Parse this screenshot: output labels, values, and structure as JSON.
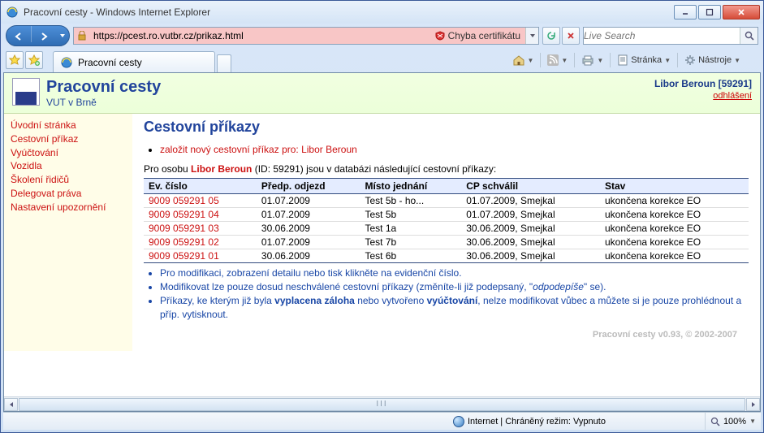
{
  "window": {
    "title": "Pracovní cesty - Windows Internet Explorer",
    "min_tooltip": "Minimize",
    "max_tooltip": "Maximize",
    "close_tooltip": "Close"
  },
  "address": {
    "url": "https://pcest.ro.vutbr.cz/prikaz.html",
    "cert_error": "Chyba certifikátu"
  },
  "search": {
    "placeholder": "Live Search"
  },
  "tab": {
    "title": "Pracovní cesty"
  },
  "cmd": {
    "page": "Stránka",
    "tools": "Nástroje"
  },
  "page": {
    "app_title": "Pracovní cesty",
    "org": "VUT v Brně",
    "user": "Libor Beroun [59291]",
    "logout": "odhlášení",
    "heading": "Cestovní příkazy",
    "new_link": "založit nový cestovní příkaz pro: Libor Beroun",
    "intro_pre": "Pro osobu ",
    "intro_name": "Libor Beroun",
    "intro_post": " (ID: 59291) jsou v databázi následující cestovní příkazy:"
  },
  "sidebar": {
    "items": [
      "Úvodní stránka",
      "Cestovní příkaz",
      "Vyúčtování",
      "Vozidla",
      "Školení řidičů",
      "Delegovat práva",
      "Nastavení upozornění"
    ]
  },
  "table": {
    "headers": {
      "ev": "Ev. číslo",
      "odjezd": "Předp. odjezd",
      "misto": "Místo jednání",
      "schvalil": "CP schválil",
      "stav": "Stav"
    },
    "rows": [
      {
        "ev": "9009 059291 05",
        "odjezd": "01.07.2009",
        "misto": "Test 5b - ho...",
        "schvalil": "01.07.2009, Smejkal",
        "stav": "ukončena korekce EO"
      },
      {
        "ev": "9009 059291 04",
        "odjezd": "01.07.2009",
        "misto": "Test 5b",
        "schvalil": "01.07.2009, Smejkal",
        "stav": "ukončena korekce EO"
      },
      {
        "ev": "9009 059291 03",
        "odjezd": "30.06.2009",
        "misto": "Test 1a",
        "schvalil": "30.06.2009, Smejkal",
        "stav": "ukončena korekce EO"
      },
      {
        "ev": "9009 059291 02",
        "odjezd": "01.07.2009",
        "misto": "Test 7b",
        "schvalil": "30.06.2009, Smejkal",
        "stav": "ukončena korekce EO"
      },
      {
        "ev": "9009 059291 01",
        "odjezd": "30.06.2009",
        "misto": "Test 6b",
        "schvalil": "30.06.2009, Smejkal",
        "stav": "ukončena korekce EO"
      }
    ]
  },
  "notes": {
    "n1": "Pro modifikaci, zobrazení detailu nebo tisk klikněte na evidenční číslo.",
    "n2_pre": "Modifikovat lze pouze dosud neschválené cestovní příkazy (změníte-li již podepsaný, \"",
    "n2_i": "odpodepíše",
    "n2_post": "\" se).",
    "n3_a": "Příkazy, ke kterým již byla ",
    "n3_b1": "vyplacena záloha",
    "n3_b": " nebo vytvořeno ",
    "n3_b2": "vyúčtování",
    "n3_c": ", nelze modifikovat vůbec a můžete si je pouze prohlédnout a příp. vytisknout."
  },
  "footer": "Pracovní cesty v0.93, © 2002-2007",
  "statusbar": {
    "zone": "Internet | Chráněný režim: Vypnuto",
    "zoom": "100%"
  }
}
